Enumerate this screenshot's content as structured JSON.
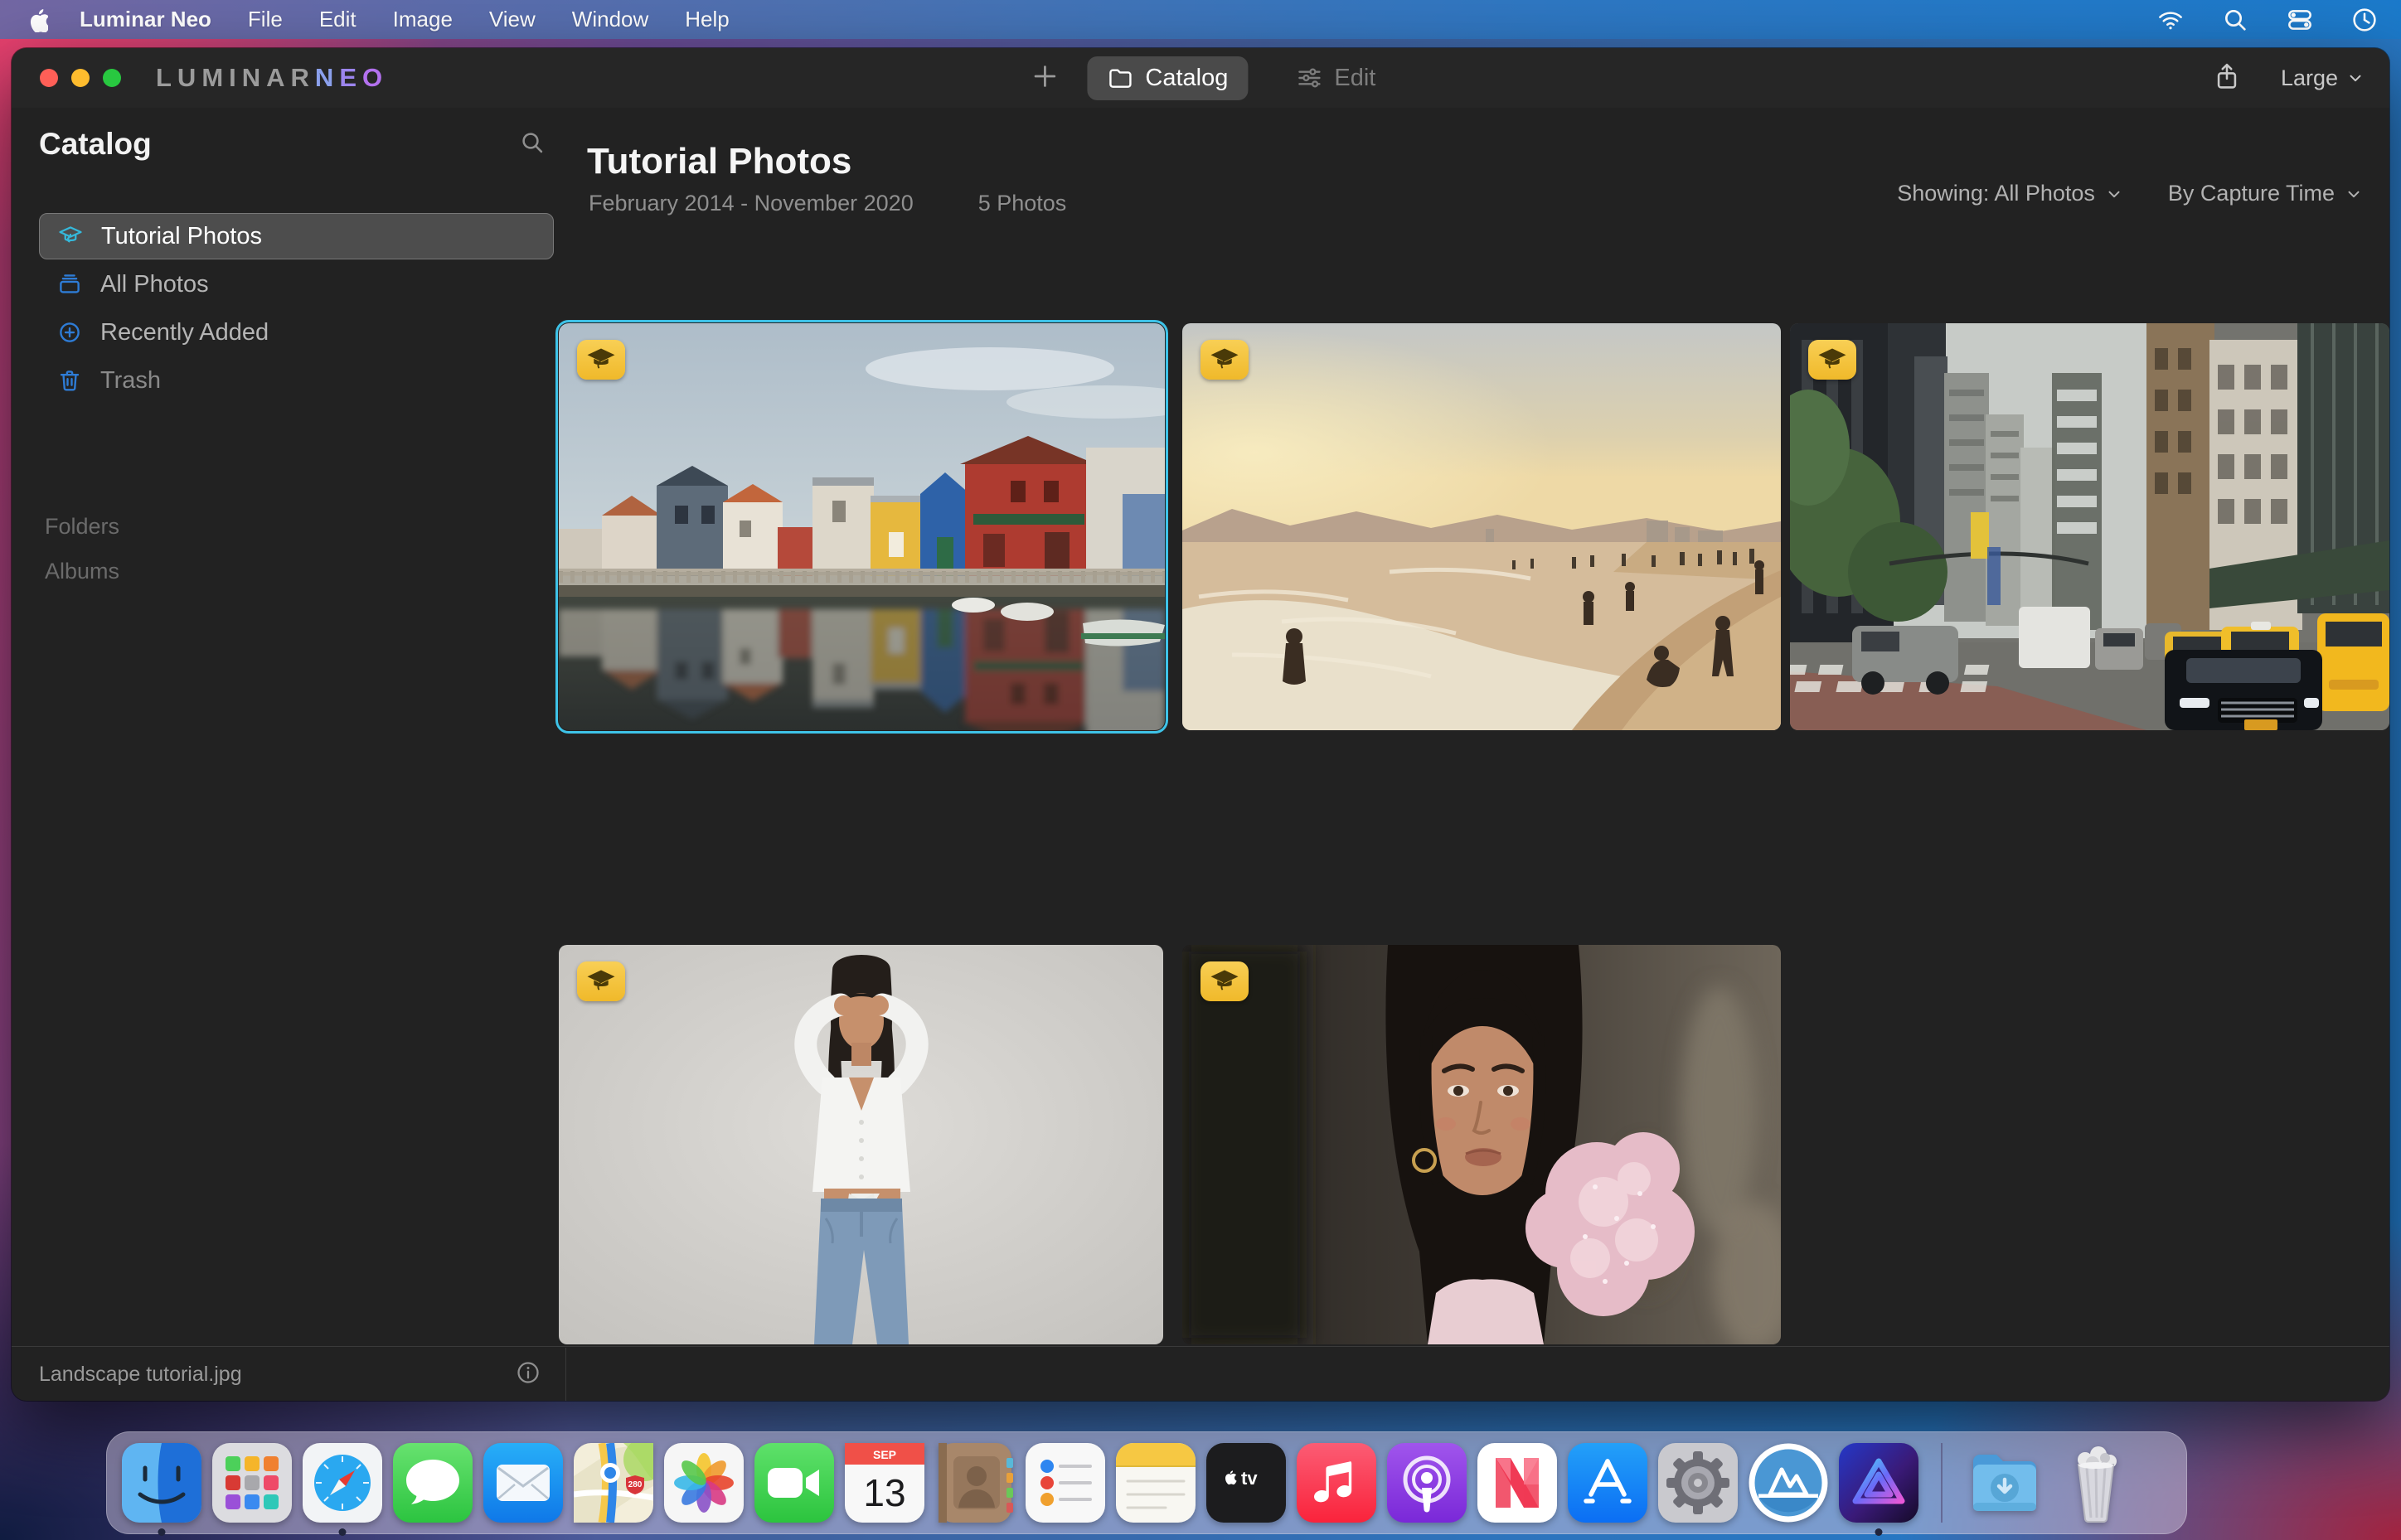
{
  "menu_bar": {
    "apple_icon": "apple-logo",
    "items": [
      "Luminar Neo",
      "File",
      "Edit",
      "Image",
      "View",
      "Window",
      "Help"
    ],
    "status_icons": [
      "wifi",
      "search",
      "control-center",
      "clock"
    ]
  },
  "window": {
    "logo": {
      "part1": "LUMINAR",
      "n": "N",
      "e": "E",
      "o": "O"
    },
    "toolbar": {
      "catalog_tab": "Catalog",
      "edit_tab": "Edit",
      "size_label": "Large"
    }
  },
  "sidebar": {
    "title": "Catalog",
    "items": [
      {
        "label": "Tutorial Photos",
        "icon": "graduation-cap",
        "selected": true
      },
      {
        "label": "All Photos",
        "icon": "photo-stack",
        "selected": false
      },
      {
        "label": "Recently Added",
        "icon": "plus-circle",
        "selected": false
      },
      {
        "label": "Trash",
        "icon": "trash",
        "selected": false
      }
    ],
    "sections": [
      "Folders",
      "Albums"
    ]
  },
  "content": {
    "title": "Tutorial Photos",
    "date_range": "February 2014 - November 2020",
    "count": "5 Photos",
    "showing_filter": "Showing: All Photos",
    "sort_filter": "By Capture Time",
    "photos": [
      {
        "name": "canal-houses",
        "badge": "tutorial",
        "selected": true
      },
      {
        "name": "beach-sunset",
        "badge": "tutorial",
        "selected": false
      },
      {
        "name": "city-street",
        "badge": "tutorial",
        "selected": false
      },
      {
        "name": "studio-portrait",
        "badge": "tutorial",
        "selected": false
      },
      {
        "name": "closeup-portrait",
        "badge": "tutorial",
        "selected": false
      }
    ]
  },
  "status_bar": {
    "filename": "Landscape tutorial.jpg",
    "info_icon": "info"
  },
  "dock": {
    "items": [
      "finder",
      "launchpad",
      "safari",
      "messages",
      "mail",
      "maps",
      "photos",
      "facetime",
      "calendar",
      "contacts",
      "reminders",
      "notes",
      "apple-tv",
      "music",
      "podcasts",
      "news",
      "app-store",
      "settings",
      "skylum",
      "luminar-neo",
      "downloads",
      "trash"
    ],
    "running": [
      "finder",
      "safari",
      "luminar-neo"
    ],
    "calendar": {
      "month": "SEP",
      "day": "13"
    },
    "maps_shield": "280",
    "apple_tv_label": "tv"
  },
  "colors": {
    "selection_accent": "#3EC3E8",
    "badge_yellow": "#F2BF33",
    "sidebar_icon_cyan": "#35B9DB",
    "sidebar_icon_blue": "#2E7CD6",
    "menubar_left": "#686AA8",
    "menubar_right": "#1B7ACB",
    "window_bg": "#222222"
  }
}
